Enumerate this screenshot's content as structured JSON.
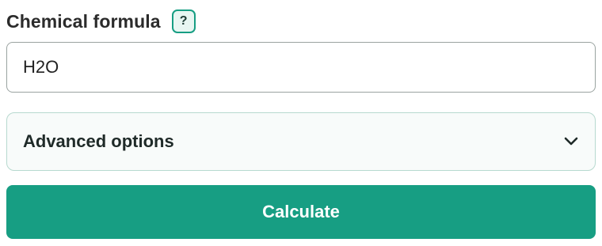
{
  "form": {
    "formula_label": "Chemical formula",
    "help_label": "?",
    "formula_value": "H2O",
    "advanced_label": "Advanced options",
    "advanced_icon": "chevron-down-icon",
    "calculate_label": "Calculate"
  },
  "colors": {
    "accent": "#179e83",
    "panel_bg": "#f8fbfa",
    "panel_border": "#b7d9cf",
    "text": "#2b2b2b"
  }
}
